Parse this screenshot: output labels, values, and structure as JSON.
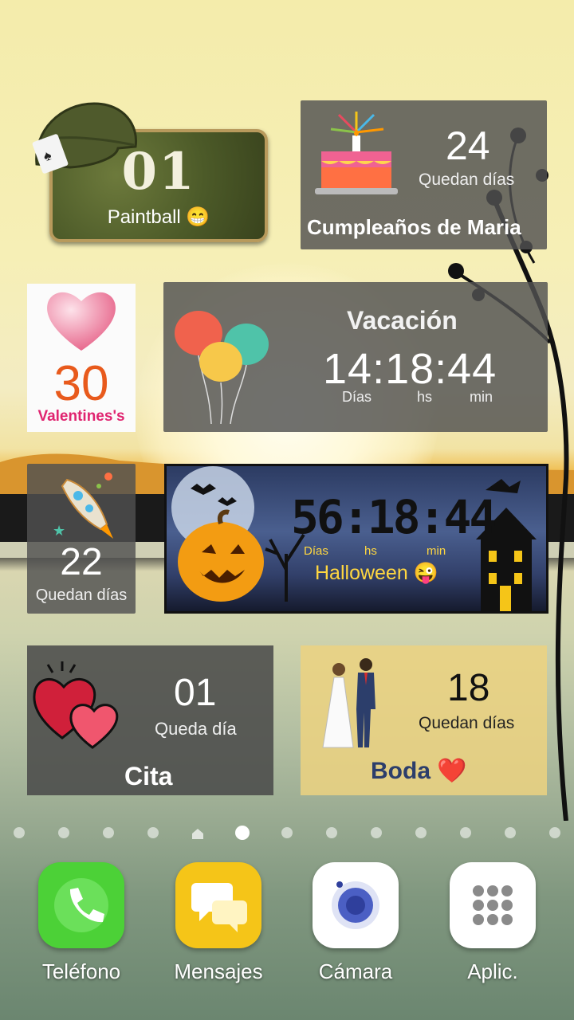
{
  "widgets": {
    "paintball": {
      "count": "01",
      "label": "Paintball 😁"
    },
    "cumpleanos": {
      "count": "24",
      "sub": "Quedan días",
      "label": "Cumpleaños de Maria"
    },
    "valentines": {
      "count": "30",
      "label": "Valentines's"
    },
    "vacacion": {
      "title": "Vacación",
      "time": "14:18:44",
      "units": [
        "Días",
        "hs",
        "min"
      ]
    },
    "rocket": {
      "count": "22",
      "sub": "Quedan días"
    },
    "halloween": {
      "time": "56:18:44",
      "units": [
        "Días",
        "hs",
        "min"
      ],
      "label": "Halloween 😜"
    },
    "cita": {
      "count": "01",
      "sub": "Queda día",
      "label": "Cita"
    },
    "boda": {
      "count": "18",
      "sub": "Quedan días",
      "label": "Boda ❤️"
    }
  },
  "page_indicator": {
    "total": 13,
    "active_index": 5,
    "home_index": 4
  },
  "dock": [
    {
      "label": "Teléfono",
      "icon": "phone-icon",
      "color": "#4cd137"
    },
    {
      "label": "Mensajes",
      "icon": "messages-icon",
      "color": "#f5c518"
    },
    {
      "label": "Cámara",
      "icon": "camera-icon",
      "color": "#ffffff"
    },
    {
      "label": "Aplic.",
      "icon": "apps-grid-icon",
      "color": "#ffffff"
    }
  ]
}
